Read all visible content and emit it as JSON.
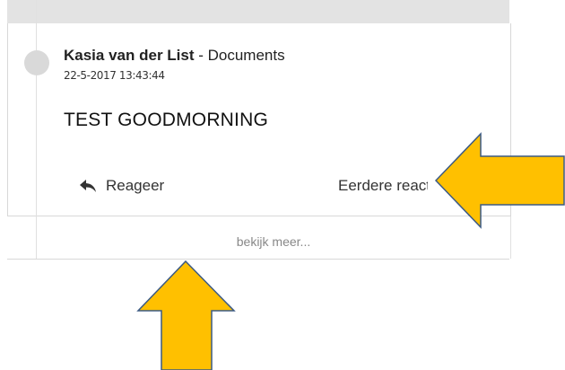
{
  "comment": {
    "author": "Kasia van der List",
    "separator": " - ",
    "context": "Documents",
    "timestamp": "22-5-2017 13:43:44",
    "message": "TEST GOODMORNING"
  },
  "actions": {
    "reply_label": "Reageer",
    "history_label": "Eerdere reacties"
  },
  "more": {
    "label": "bekijk meer..."
  },
  "colors": {
    "arrow_fill": "#ffc000",
    "arrow_stroke": "#3b5a84"
  },
  "icons": {
    "reply": "reply-arrow-icon",
    "history": "history-icon",
    "avatar": "avatar-placeholder"
  }
}
